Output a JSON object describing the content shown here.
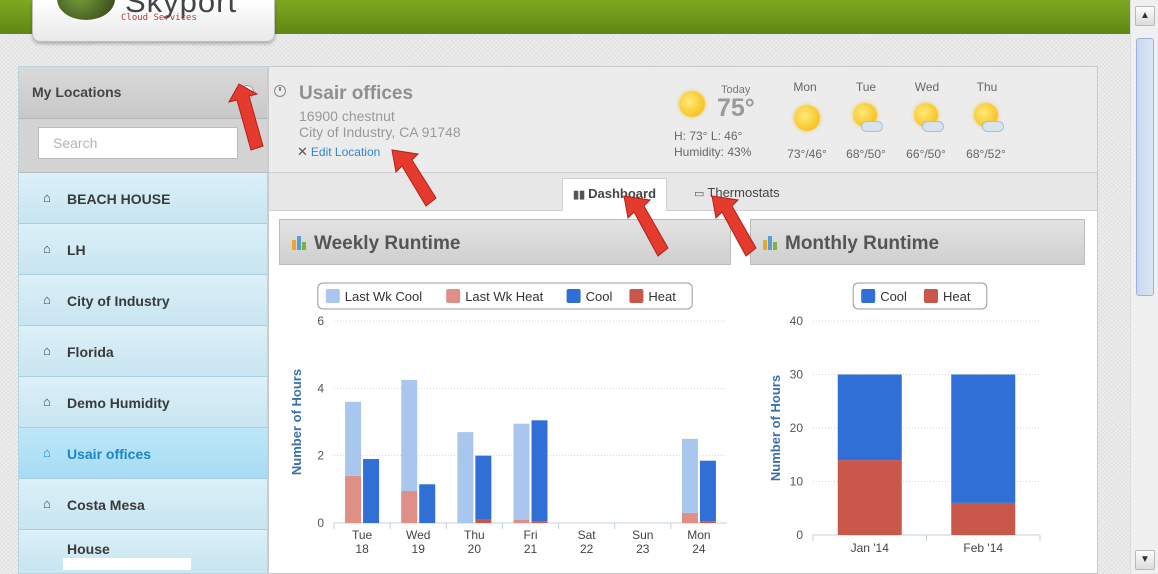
{
  "logo": {
    "word": "Skyport",
    "sub": "Cloud Services"
  },
  "sidebar": {
    "title": "My Locations",
    "search_placeholder": "Search",
    "items": [
      {
        "label": "BEACH HOUSE"
      },
      {
        "label": "LH"
      },
      {
        "label": "City of Industry"
      },
      {
        "label": "Florida"
      },
      {
        "label": "Demo Humidity"
      },
      {
        "label": "Usair offices",
        "active": true
      },
      {
        "label": "Costa Mesa"
      },
      {
        "label": "House"
      }
    ]
  },
  "location": {
    "name": "Usair offices",
    "address_line1": "16900 chestnut",
    "address_line2": "City of Industry, CA 91748",
    "edit_label": "Edit Location"
  },
  "weather": {
    "today_label": "Today",
    "today_temp": "75°",
    "hi_lo": "H: 73° L: 46°",
    "humidity": "Humidity: 43%",
    "forecast": [
      {
        "day": "Mon",
        "temps": "73°/46°",
        "icon": "sunny-icon"
      },
      {
        "day": "Tue",
        "temps": "68°/50°",
        "icon": "partly-cloudy-icon"
      },
      {
        "day": "Wed",
        "temps": "66°/50°",
        "icon": "partly-cloudy-icon"
      },
      {
        "day": "Thu",
        "temps": "68°/52°",
        "icon": "partly-cloudy-icon"
      }
    ]
  },
  "tabs": [
    {
      "label": "Dashboard",
      "active": true
    },
    {
      "label": "Thermostats"
    }
  ],
  "panels": {
    "weekly_title": "Weekly Runtime",
    "monthly_title": "Monthly Runtime"
  },
  "colors": {
    "last_wk_cool": "#a9c7ee",
    "last_wk_heat": "#e08f86",
    "cool": "#2f6fd6",
    "heat": "#c9574a",
    "arrow": "#e53b2e"
  },
  "chart_data": [
    {
      "type": "bar",
      "title": "Weekly Runtime",
      "ylabel": "Number of Hours",
      "ylim": [
        0,
        6
      ],
      "yticks": [
        0,
        2,
        4,
        6
      ],
      "categories": [
        "Tue 18",
        "Wed 19",
        "Thu 20",
        "Fri 21",
        "Sat 22",
        "Sun 23",
        "Mon 24"
      ],
      "category_lines": [
        [
          "Tue",
          "18"
        ],
        [
          "Wed",
          "19"
        ],
        [
          "Thu",
          "20"
        ],
        [
          "Fri",
          "21"
        ],
        [
          "Sat",
          "22"
        ],
        [
          "Sun",
          "23"
        ],
        [
          "Mon",
          "24"
        ]
      ],
      "legend": [
        "Last Wk Cool",
        "Last Wk Heat",
        "Cool",
        "Heat"
      ],
      "legend_placement": "top",
      "series": [
        {
          "name": "Last Wk Cool",
          "stack": "last_week",
          "values": [
            2.2,
            3.3,
            2.7,
            2.85,
            0,
            0,
            2.2
          ]
        },
        {
          "name": "Last Wk Heat",
          "stack": "last_week",
          "values": [
            1.4,
            0.95,
            0,
            0.1,
            0,
            0,
            0.3
          ]
        },
        {
          "name": "Cool",
          "stack": "this_week",
          "values": [
            1.9,
            1.15,
            1.9,
            3.0,
            0,
            0,
            1.8
          ]
        },
        {
          "name": "Heat",
          "stack": "this_week",
          "values": [
            0,
            0,
            0.1,
            0.05,
            0,
            0,
            0.05
          ]
        }
      ]
    },
    {
      "type": "bar",
      "title": "Monthly Runtime",
      "ylabel": "Number of Hours",
      "ylim": [
        0,
        40
      ],
      "yticks": [
        0,
        10,
        20,
        30,
        40
      ],
      "categories": [
        "Jan '14",
        "Feb '14"
      ],
      "legend": [
        "Cool",
        "Heat"
      ],
      "legend_placement": "top",
      "series": [
        {
          "name": "Heat",
          "values": [
            14,
            6
          ]
        },
        {
          "name": "Cool",
          "values": [
            16,
            24
          ]
        }
      ]
    }
  ]
}
